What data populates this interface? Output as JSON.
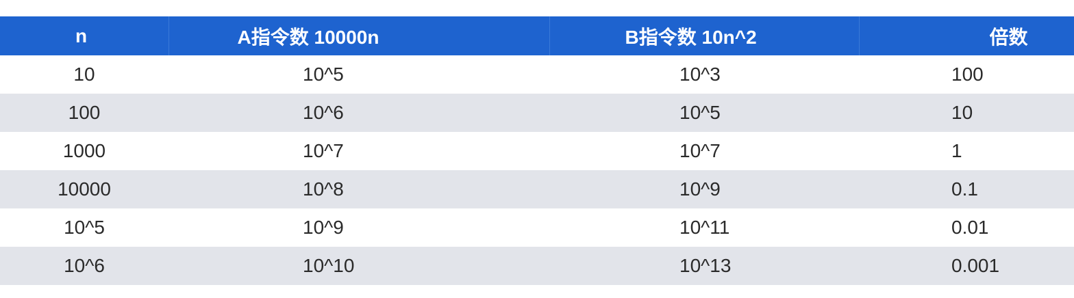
{
  "table": {
    "header_color": "#1e63cf",
    "stripe_color": "#e2e4ea",
    "columns": [
      "n",
      "A指令数 10000n",
      "B指令数 10n^2",
      "倍数"
    ],
    "rows": [
      [
        "10",
        "10^5",
        "10^3",
        "100"
      ],
      [
        "100",
        "10^6",
        "10^5",
        "10"
      ],
      [
        "1000",
        "10^7",
        "10^7",
        "1"
      ],
      [
        "10000",
        "10^8",
        "10^9",
        "0.1"
      ],
      [
        "10^5",
        "10^9",
        "10^11",
        "0.01"
      ],
      [
        "10^6",
        "10^10",
        "10^13",
        "0.001"
      ]
    ]
  }
}
